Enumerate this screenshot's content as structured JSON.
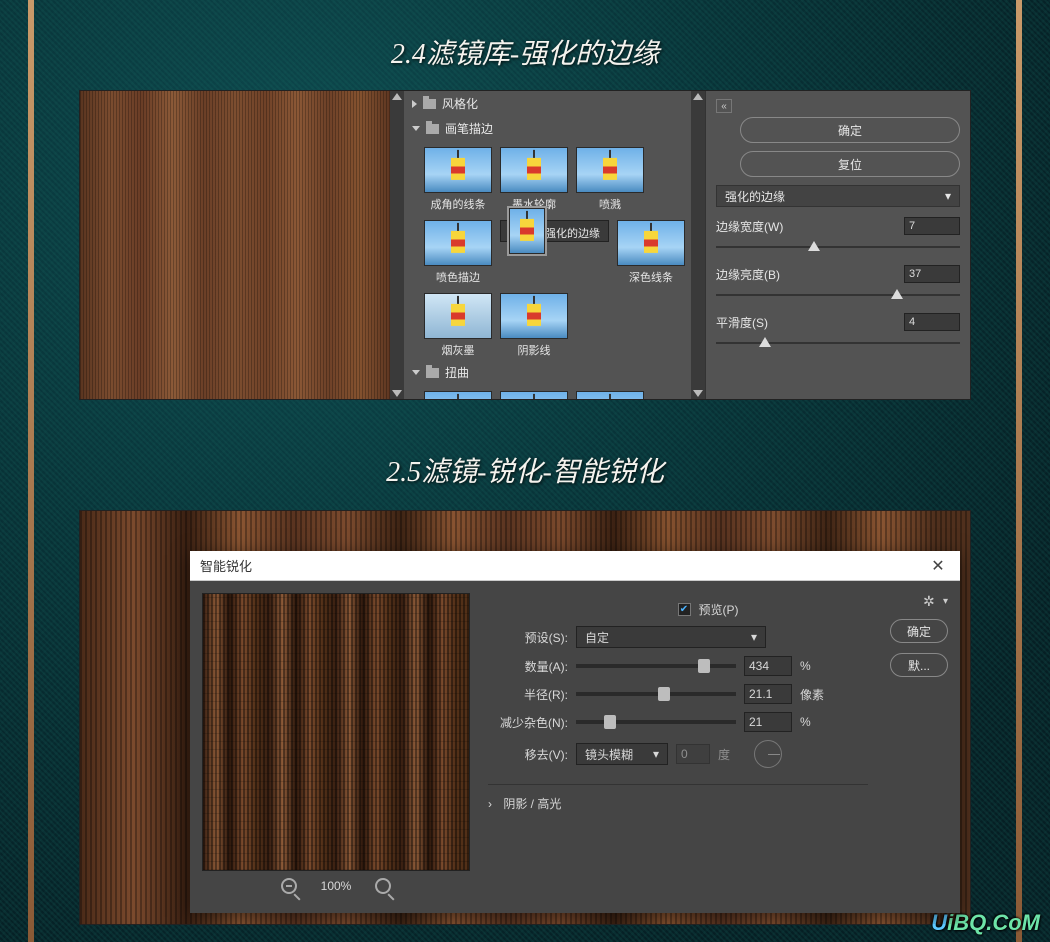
{
  "section1_title": "2.4滤镜库-强化的边缘",
  "section2_title": "2.5滤镜-锐化-智能锐化",
  "filter_gallery": {
    "cat_stylize": "风格化",
    "cat_brush": "画笔描边",
    "cat_distort": "扭曲",
    "thumbs": {
      "angled": "成角的线条",
      "ink": "墨水轮廓",
      "spatter": "喷溅",
      "sprayed": "喷色描边",
      "accented": "强化的边缘",
      "dark": "深色线条",
      "sumi": "烟灰墨",
      "crosshatch": "阴影线"
    },
    "ok": "确定",
    "reset": "复位",
    "effect_name": "强化的边缘",
    "edge_width_label": "边缘宽度(W)",
    "edge_width_value": "7",
    "edge_brightness_label": "边缘亮度(B)",
    "edge_brightness_value": "37",
    "smoothness_label": "平滑度(S)",
    "smoothness_value": "4"
  },
  "smart_sharpen": {
    "title": "智能锐化",
    "preview_label": "预览(P)",
    "preset_label": "预设(S):",
    "preset_value": "自定",
    "amount_label": "数量(A):",
    "amount_value": "434",
    "amount_unit": "%",
    "radius_label": "半径(R):",
    "radius_value": "21.1",
    "radius_unit": "像素",
    "noise_label": "减少杂色(N):",
    "noise_value": "21",
    "noise_unit": "%",
    "remove_label": "移去(V):",
    "remove_value": "镜头模糊",
    "angle_value": "0",
    "angle_unit": "度",
    "shadows_highlights": "阴影 / 高光",
    "zoom": "100%",
    "ok": "确定",
    "default": "默..."
  },
  "watermark": "UiBQ.CoM"
}
